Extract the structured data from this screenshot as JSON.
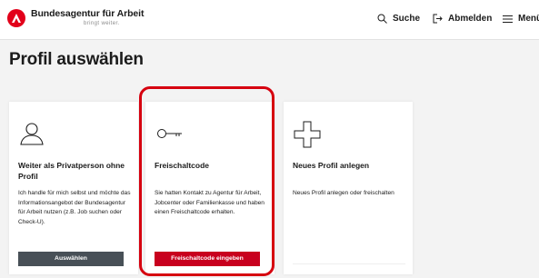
{
  "header": {
    "logo_name": "Bundesagentur für Arbeit",
    "logo_claim": "bringt weiter.",
    "nav": {
      "search": "Suche",
      "logout": "Abmelden",
      "menu": "Menü"
    }
  },
  "page": {
    "title": "Profil auswählen"
  },
  "cards": [
    {
      "icon": "person-icon",
      "title": "Weiter als Privatperson ohne Profil",
      "text": "Ich handle für mich selbst und möchte das Informationsangebot der Bundesagentur für Arbeit nutzen (z.B. Job suchen oder Check-U).",
      "button": "Auswählen"
    },
    {
      "icon": "key-icon",
      "title": "Freischaltcode",
      "text": "Sie hatten Kontakt zu Agentur für Arbeit, Jobcenter oder Familienkasse und haben einen Freischaltcode erhalten.",
      "button": "Freischaltcode eingeben"
    },
    {
      "icon": "plus-icon",
      "title": "Neues Profil anlegen",
      "text": "Neues Profil anlegen oder freischalten"
    }
  ],
  "colors": {
    "brand_red": "#e2001a",
    "button_red": "#c8001e",
    "button_grey": "#485057",
    "highlight": "#d6000f"
  }
}
